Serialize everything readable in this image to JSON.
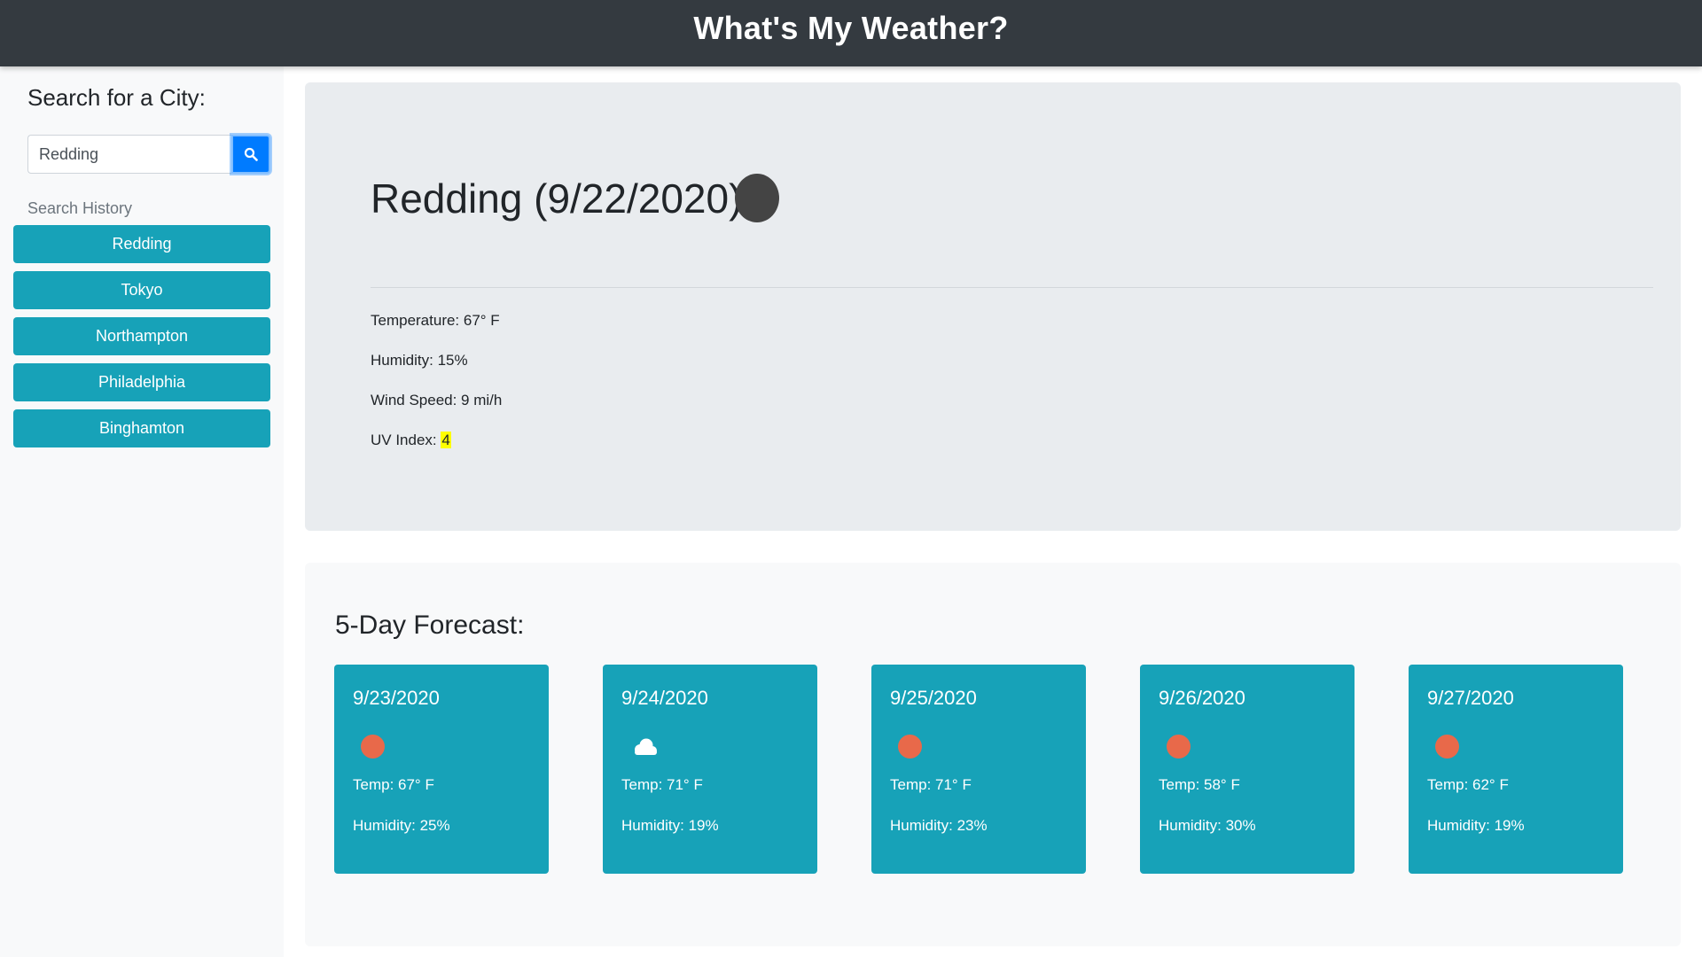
{
  "header": {
    "title": "What's My Weather?"
  },
  "sidebar": {
    "heading": "Search for a City:",
    "search": {
      "value": "Redding",
      "button_icon": "search-icon"
    },
    "history_label": "Search History",
    "history": [
      "Redding",
      "Tokyo",
      "Northampton",
      "Philadelphia",
      "Binghamton"
    ]
  },
  "current": {
    "title": "Redding (9/22/2020)",
    "icon": "weather-icon",
    "temperature": "Temperature: 67° F",
    "humidity": "Humidity: 15%",
    "wind": "Wind Speed: 9 mi/h",
    "uv_label": "UV Index: ",
    "uv_value": "4",
    "uv_color": "#ffff00"
  },
  "forecast": {
    "heading": "5-Day Forecast:",
    "days": [
      {
        "date": "9/23/2020",
        "icon": "sun-icon",
        "temp": "Temp: 67° F",
        "humidity": "Humidity: 25%"
      },
      {
        "date": "9/24/2020",
        "icon": "cloud-icon",
        "temp": "Temp: 71° F",
        "humidity": "Humidity: 19%"
      },
      {
        "date": "9/25/2020",
        "icon": "sun-icon",
        "temp": "Temp: 71° F",
        "humidity": "Humidity: 23%"
      },
      {
        "date": "9/26/2020",
        "icon": "sun-icon",
        "temp": "Temp: 58° F",
        "humidity": "Humidity: 30%"
      },
      {
        "date": "9/27/2020",
        "icon": "sun-icon",
        "temp": "Temp: 62° F",
        "humidity": "Humidity: 19%"
      }
    ]
  },
  "colors": {
    "header_bg": "#343a40",
    "accent": "#17a2b8",
    "search_button": "#007bff",
    "sun": "#e8694a"
  }
}
